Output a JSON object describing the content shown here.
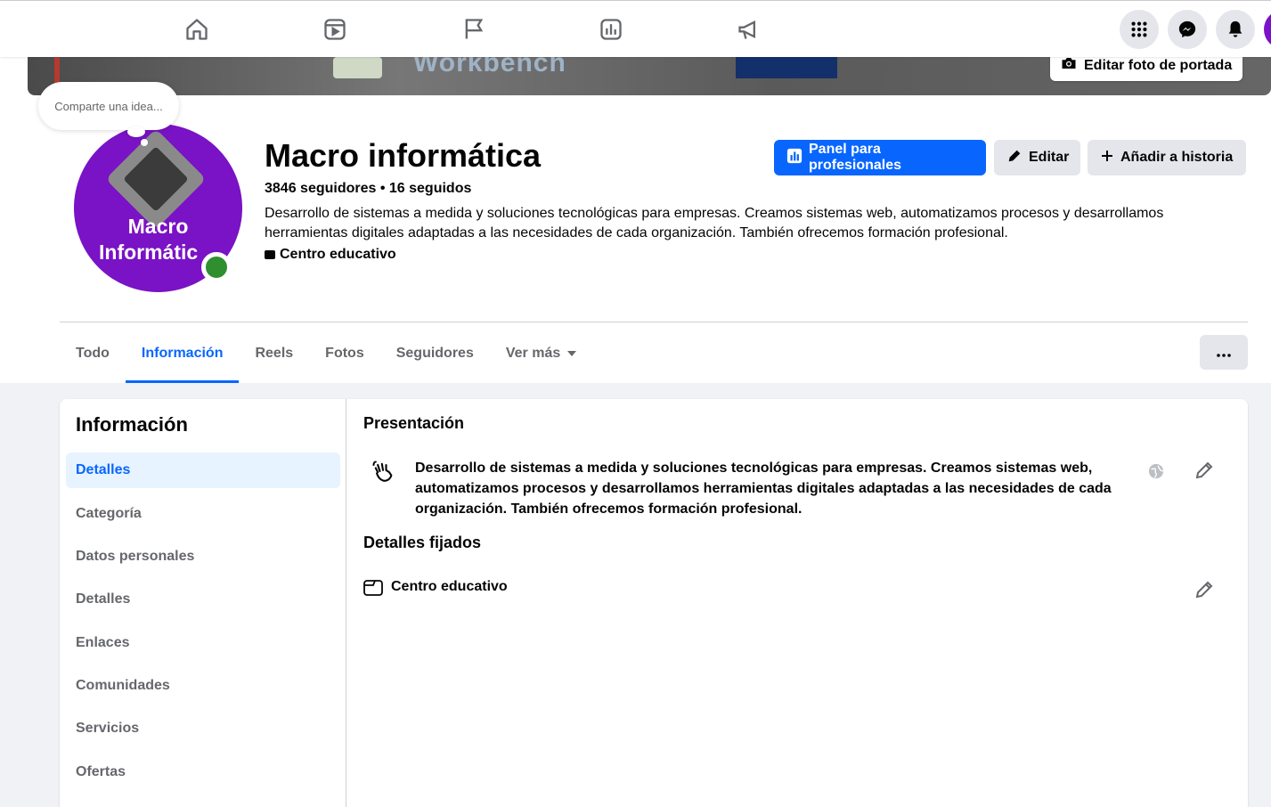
{
  "nav": {
    "icons": [
      "home-icon",
      "reels-icon",
      "pages-flag-icon",
      "insights-icon",
      "ads-megaphone-icon"
    ],
    "right_icons": [
      "apps-grid-icon",
      "messenger-icon",
      "notifications-bell-icon"
    ]
  },
  "cover": {
    "edit_button": "Editar foto de portada",
    "visible_text": "Workbench"
  },
  "thought": {
    "placeholder": "Comparte una idea..."
  },
  "profile": {
    "picture_text_1": "Macro",
    "picture_text_2": "Informátic",
    "name": "Macro informática",
    "stats": "3846 seguidores • 16 seguidos",
    "bio": "Desarrollo de sistemas a medida y soluciones tecnológicas para empresas. Creamos sistemas web, automatizamos procesos y desarrollamos herramientas digitales adaptadas a las necesidades de cada organización. También ofrecemos formación profesional.",
    "category": "Centro educativo"
  },
  "actions": {
    "pro_panel": "Panel para profesionales",
    "edit": "Editar",
    "add_story": "Añadir a historia"
  },
  "tabs": [
    {
      "label": "Todo"
    },
    {
      "label": "Información"
    },
    {
      "label": "Reels"
    },
    {
      "label": "Fotos"
    },
    {
      "label": "Seguidores"
    },
    {
      "label": "Ver más"
    }
  ],
  "about": {
    "title": "Información",
    "menu": [
      "Detalles",
      "Categoría",
      "Datos personales",
      "Detalles",
      "Enlaces",
      "Comunidades",
      "Servicios",
      "Ofertas"
    ],
    "presentation_title": "Presentación",
    "presentation_text": "Desarrollo de sistemas a medida y soluciones tecnológicas para empresas. Creamos sistemas web, automatizamos procesos y desarrollamos herramientas digitales adaptadas a las necesidades de cada organización. También ofrecemos formación profesional.",
    "pinned_title": "Detalles fijados",
    "pinned_category": "Centro educativo"
  },
  "colors": {
    "accent": "#0866ff",
    "profile_bg": "#7a12c5",
    "online": "#2f8f2f"
  }
}
